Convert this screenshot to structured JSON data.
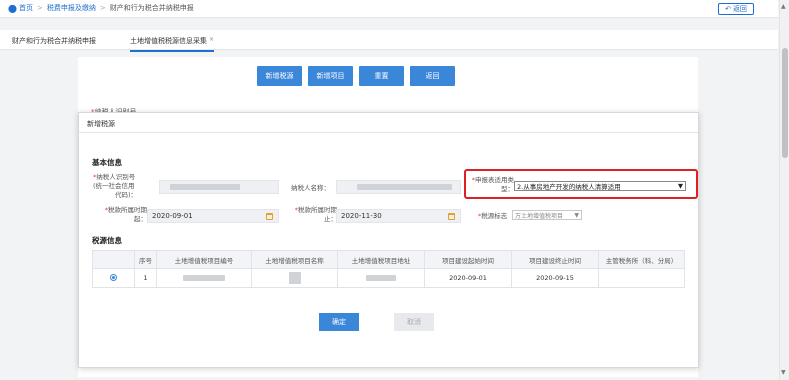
{
  "breadcrumb": {
    "home": "首页",
    "level1": "税费申报及缴纳",
    "level2": "财产和行为税合并纳税申报",
    "separator": ">"
  },
  "back_button": "返回",
  "tabs": [
    {
      "label": "财产和行为税合并纳税申报"
    },
    {
      "label": "土地增值税税源信息采集",
      "close": "×"
    }
  ],
  "toolbar": {
    "add_source": "新增税源",
    "add_project": "新增项目",
    "reset": "重置",
    "back": "返回"
  },
  "background_field": {
    "required_mark": "*",
    "label": "纳税人识别号"
  },
  "modal": {
    "title": "新增税源",
    "basic_info_title": "基本信息",
    "required_mark": "*",
    "taxpayer_id_label_1": "纳税人识别号",
    "taxpayer_id_label_2": "(统一社会信用",
    "taxpayer_id_label_3": "代码)：",
    "taxpayer_name_label": "纳税人名称：",
    "form_type_label_1": "申报表适用类",
    "form_type_label_2": "型：",
    "form_type_value": "2.从事房地产开发的纳税人清算适用",
    "period_start_label_1": "税款所属时期",
    "period_start_label_2": "起：",
    "period_start_value": "2020-09-01",
    "period_end_label_1": "税款所属时期",
    "period_end_label_2": "止：",
    "period_end_value": "2020-11-30",
    "tax_item_label": "税源标志",
    "tax_item_value": "万土地增值税项目",
    "source_info_title": "税源信息",
    "table": {
      "headers": [
        "",
        "序号",
        "土地增值税项目编号",
        "土地增值税项目名称",
        "土地增值税项目地址",
        "项目建设起始时间",
        "项目建设终止时间",
        "主管税务所（科、分局）"
      ],
      "rows": [
        {
          "seq": "1",
          "start": "2020-09-01",
          "end": "2020-09-15"
        }
      ]
    },
    "ok_button": "确定",
    "cancel_button": "取消"
  },
  "colors": {
    "accent": "#3a86d9",
    "highlight_border": "#e02020",
    "required": "#e33333"
  }
}
